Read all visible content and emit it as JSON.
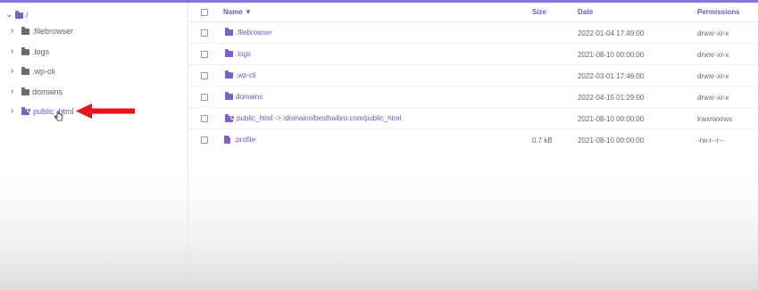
{
  "tree": {
    "root_label": "/",
    "items": [
      {
        "label": ".filebrowser",
        "icon": "folder-icon"
      },
      {
        "label": ".logs",
        "icon": "folder-icon"
      },
      {
        "label": ".wp-cli",
        "icon": "folder-icon"
      },
      {
        "label": "domains",
        "icon": "folder-icon"
      },
      {
        "label": "public_html",
        "icon": "folder-link-icon"
      }
    ]
  },
  "table": {
    "columns": {
      "name": "Name ▼",
      "size": "Size",
      "date": "Date",
      "permissions": "Permissions"
    },
    "rows": [
      {
        "name": ".filebrowser",
        "type": "folder",
        "size": "",
        "date": "2022-01-04 17:49:00",
        "permissions": "drwxr-xr-x"
      },
      {
        "name": ".logs",
        "type": "folder",
        "size": "",
        "date": "2021-08-10 00:00:00",
        "permissions": "drwxr-xr-x"
      },
      {
        "name": ".wp-cli",
        "type": "folder",
        "size": "",
        "date": "2022-03-01 17:46:00",
        "permissions": "drwxr-xr-x"
      },
      {
        "name": "domains",
        "type": "folder",
        "size": "",
        "date": "2022-04-15 01:29:00",
        "permissions": "drwxr-xr-x"
      },
      {
        "name": "public_html -> /domains/besthaibro.com/public_html",
        "type": "link",
        "size": "",
        "date": "2021-08-10 00:00:00",
        "permissions": "lrwxrwxrwx"
      },
      {
        "name": ".profile",
        "type": "file",
        "size": "0.7 kB",
        "date": "2021-08-10 00:00:00",
        "permissions": "-rw-r--r--"
      }
    ]
  },
  "colors": {
    "accent": "#7b61c9",
    "arrow": "#e8141b"
  }
}
